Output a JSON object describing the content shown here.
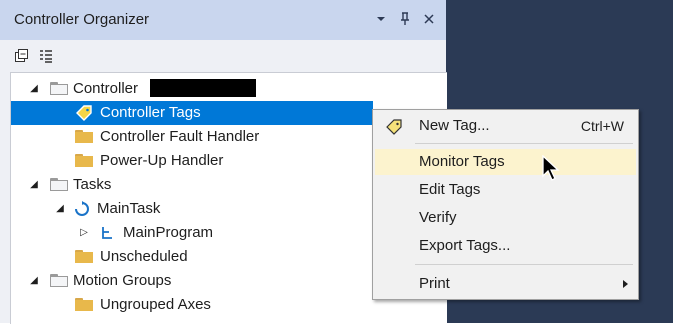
{
  "panel": {
    "title": "Controller Organizer",
    "dropdown_icon": "chevron-down-icon",
    "pin_icon": "pin-icon",
    "close_icon": "close-icon"
  },
  "toolbar": {
    "icons": [
      "collapse-all-icon",
      "show-details-icon"
    ]
  },
  "tree": {
    "items": [
      {
        "label": "Controller",
        "icon": "folder-open-icon",
        "expanded": true
      },
      {
        "label": "Controller Tags",
        "icon": "tag-icon",
        "selected": true
      },
      {
        "label": "Controller Fault Handler",
        "icon": "folder-icon"
      },
      {
        "label": "Power-Up Handler",
        "icon": "folder-icon"
      },
      {
        "label": "Tasks",
        "icon": "folder-open-icon",
        "expanded": true
      },
      {
        "label": "MainTask",
        "icon": "task-cycle-icon",
        "expanded": true
      },
      {
        "label": "MainProgram",
        "icon": "program-icon",
        "expanded": false
      },
      {
        "label": "Unscheduled",
        "icon": "folder-icon"
      },
      {
        "label": "Motion Groups",
        "icon": "folder-open-icon",
        "expanded": true
      },
      {
        "label": "Ungrouped Axes",
        "icon": "folder-icon"
      }
    ]
  },
  "context_menu": {
    "items": [
      {
        "label": "New Tag...",
        "shortcut": "Ctrl+W",
        "icon": "tag-icon"
      },
      {
        "label": "Monitor Tags",
        "highlighted": true
      },
      {
        "label": "Edit Tags"
      },
      {
        "label": "Verify"
      },
      {
        "label": "Export Tags..."
      },
      {
        "label": "Print",
        "submenu": true
      }
    ]
  },
  "colors": {
    "selection": "#0078d7",
    "menu_highlight": "#fcf3ce",
    "titlebar": "#c9d6ee",
    "dark_background": "#2b3a55"
  }
}
